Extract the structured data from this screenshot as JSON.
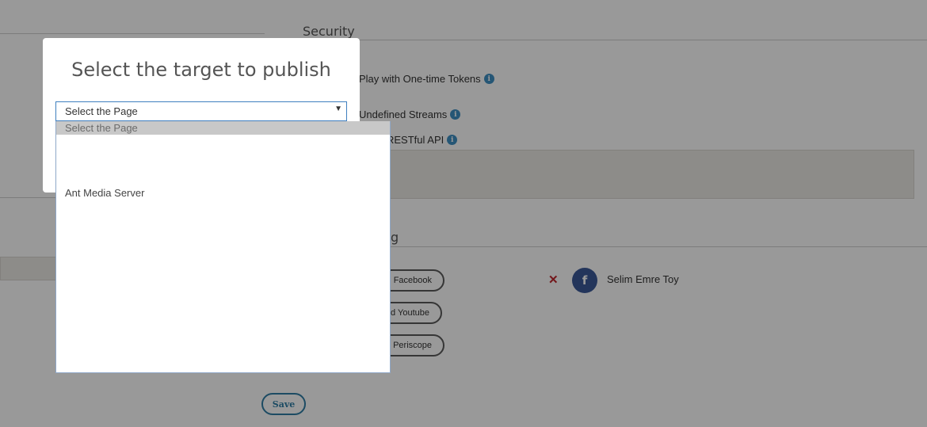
{
  "background": {
    "security_title": "Security",
    "options": [
      {
        "label": "Play with One-time Tokens"
      },
      {
        "label": "Undefined Streams"
      },
      {
        "label": "RESTful API"
      }
    ],
    "streaming_title_fragment": "g",
    "social_buttons": [
      {
        "label": "l Facebook"
      },
      {
        "label": "d Youtube"
      },
      {
        "label": "l Periscope"
      }
    ],
    "connected_account": {
      "remove_symbol": "✕",
      "avatar_letter": "f",
      "name": "Selim Emre Toy"
    },
    "save_label": "Save"
  },
  "modal": {
    "title": "Select the target to publish",
    "select": {
      "value": "Select the Page",
      "arrow": "▼",
      "options": [
        {
          "label": "Select the Page"
        },
        {
          "label": "Ant Media Server"
        }
      ]
    }
  },
  "icons": {
    "info": "i"
  },
  "colors": {
    "accent": "#2f7ea6",
    "facebook": "#3b5998",
    "remove": "#c0272d",
    "info": "#3f8fc4"
  }
}
